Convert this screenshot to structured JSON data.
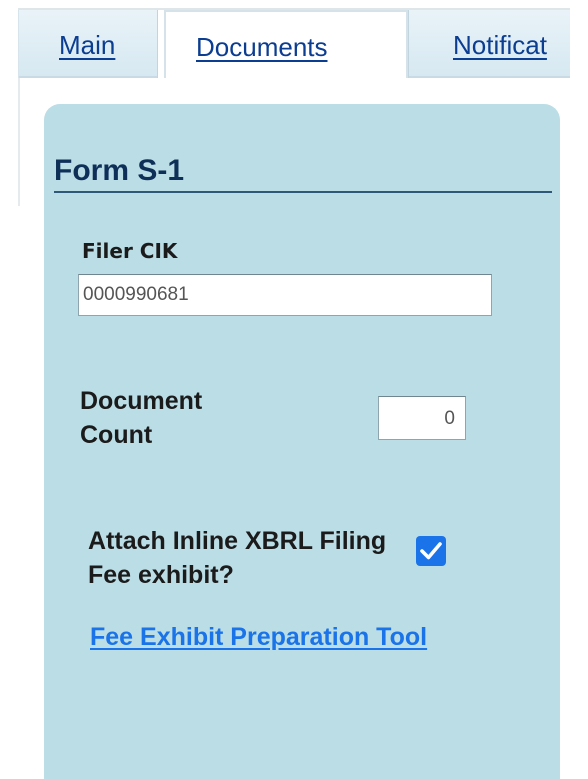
{
  "tabs": {
    "main_label": "Main",
    "documents_label": "Documents",
    "notifications_label": "Notificat"
  },
  "panel": {
    "form_title": "Form S-1",
    "filer_cik_label": "Filer CIK",
    "filer_cik_value": "0000990681",
    "document_count_label": "Document Count",
    "document_count_value": "0",
    "attach_label": "Attach Inline XBRL Filing Fee exhibit?",
    "attach_checked": true,
    "fee_link_label": "Fee Exhibit Preparation Tool"
  },
  "colors": {
    "panel_bg": "#bbdde6",
    "link": "#1a73e8",
    "checkbox": "#1a73e8",
    "title": "#0e2f57"
  },
  "icons": {
    "checkbox": "checkmark-icon"
  }
}
